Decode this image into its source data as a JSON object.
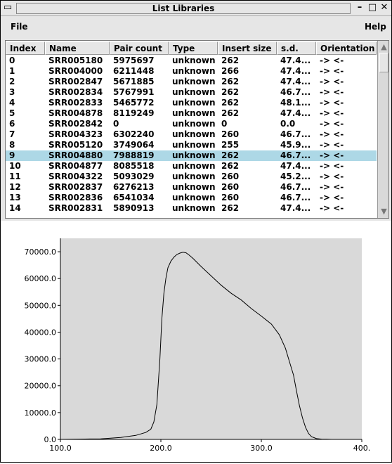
{
  "window": {
    "title": "List Libraries",
    "controls": {
      "menu": "▭",
      "minimize": "–",
      "maximize": "□",
      "close": "✕"
    }
  },
  "menu": {
    "file": "File",
    "help": "Help"
  },
  "table": {
    "columns": [
      "Index",
      "Name",
      "Pair count",
      "Type",
      "Insert size",
      "s.d.",
      "Orientation"
    ],
    "selected_index": 9,
    "rows": [
      [
        "0",
        "SRR005180",
        "5975697",
        "unknown",
        "262",
        "47.4...",
        "-> <-"
      ],
      [
        "1",
        "SRR004000",
        "6211448",
        "unknown",
        "266",
        "47.4...",
        "-> <-"
      ],
      [
        "2",
        "SRR002847",
        "5671885",
        "unknown",
        "262",
        "47.4...",
        "-> <-"
      ],
      [
        "3",
        "SRR002834",
        "5767991",
        "unknown",
        "262",
        "46.7...",
        "-> <-"
      ],
      [
        "4",
        "SRR002833",
        "5465772",
        "unknown",
        "262",
        "48.1...",
        "-> <-"
      ],
      [
        "5",
        "SRR004878",
        "8119249",
        "unknown",
        "262",
        "47.4...",
        "-> <-"
      ],
      [
        "6",
        "SRR002842",
        "0",
        "unknown",
        "0",
        "0.0",
        "-> <-"
      ],
      [
        "7",
        "SRR004323",
        "6302240",
        "unknown",
        "260",
        "46.7...",
        "-> <-"
      ],
      [
        "8",
        "SRR005120",
        "3749064",
        "unknown",
        "255",
        "45.9...",
        "-> <-"
      ],
      [
        "9",
        "SRR004880",
        "7988819",
        "unknown",
        "262",
        "46.7...",
        "-> <-"
      ],
      [
        "10",
        "SRR004877",
        "8085518",
        "unknown",
        "262",
        "47.4...",
        "-> <-"
      ],
      [
        "11",
        "SRR004322",
        "5093029",
        "unknown",
        "260",
        "45.2...",
        "-> <-"
      ],
      [
        "12",
        "SRR002837",
        "6276213",
        "unknown",
        "260",
        "46.7...",
        "-> <-"
      ],
      [
        "13",
        "SRR002836",
        "6541034",
        "unknown",
        "260",
        "46.7...",
        "-> <-"
      ],
      [
        "14",
        "SRR002831",
        "5890913",
        "unknown",
        "262",
        "47.4...",
        "-> <-"
      ]
    ]
  },
  "colors": {
    "selection": "#add8e6",
    "plot_bg": "#d9d9d9",
    "line": "#000000"
  },
  "chart_data": {
    "type": "line",
    "xlim": [
      100,
      400
    ],
    "ylim": [
      0,
      75000
    ],
    "x_ticks": [
      "100.0",
      "200.0",
      "300.0",
      "400."
    ],
    "y_ticks": [
      "0.0",
      "10000.0",
      "20000.0",
      "30000.0",
      "40000.0",
      "50000.0",
      "60000.0",
      "70000.0"
    ],
    "grid": false,
    "series": [
      {
        "x": [
          100,
          120,
          140,
          160,
          175,
          185,
          190,
          193,
          196,
          199,
          201,
          203,
          205,
          207,
          210,
          213,
          216,
          219,
          222,
          225,
          228,
          232,
          240,
          250,
          260,
          270,
          280,
          290,
          300,
          310,
          318,
          324,
          328,
          332,
          335,
          338,
          341,
          344,
          347,
          350,
          355,
          360,
          365,
          370,
          380
        ],
        "y": [
          0,
          100,
          200,
          700,
          1500,
          2600,
          3800,
          6500,
          13000,
          30000,
          45000,
          54500,
          60000,
          64000,
          66500,
          68000,
          69000,
          69500,
          69800,
          69600,
          68800,
          67500,
          64500,
          61000,
          57500,
          54500,
          52000,
          48800,
          46000,
          43000,
          39000,
          34000,
          29000,
          24000,
          18000,
          12500,
          8000,
          4500,
          2200,
          1000,
          300,
          100,
          50,
          0,
          0
        ]
      }
    ]
  }
}
